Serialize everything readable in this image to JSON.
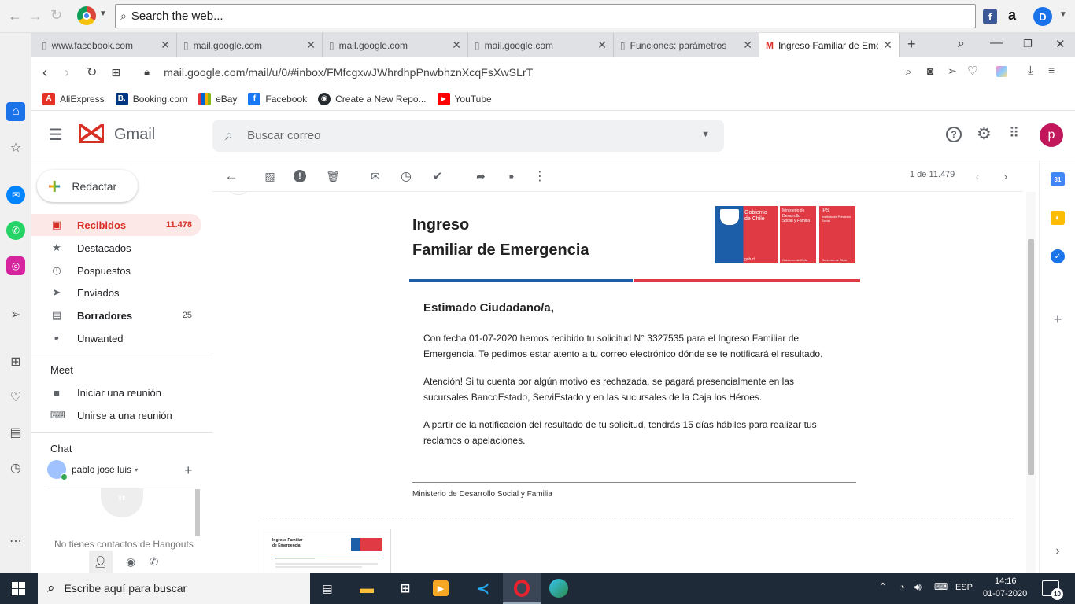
{
  "browser": {
    "search_placeholder": "Search the web...",
    "url": "mail.google.com/mail/u/0/#inbox/FMfcgxwJWhrdhpPnwbhznXcqFsXwSLrT",
    "tabs": [
      {
        "title": "www.facebook.com"
      },
      {
        "title": "mail.google.com"
      },
      {
        "title": "mail.google.com"
      },
      {
        "title": "mail.google.com"
      },
      {
        "title": "Funciones: parámetros"
      },
      {
        "title": "Ingreso Familiar de Emer"
      }
    ],
    "bookmarks": [
      {
        "label": "AliExpress",
        "color": "#e43225",
        "glyph": "A"
      },
      {
        "label": "Booking.com",
        "color": "#003580",
        "glyph": "B."
      },
      {
        "label": "eBay",
        "color": "#86b817",
        "glyph": "e"
      },
      {
        "label": "Facebook",
        "color": "#1877f2",
        "glyph": "f"
      },
      {
        "label": "Create a New Repo...",
        "color": "#24292e",
        "glyph": "◉"
      },
      {
        "label": "YouTube",
        "color": "#ff0000",
        "glyph": "▶"
      }
    ]
  },
  "gmail": {
    "logo_text": "Gmail",
    "search_placeholder": "Buscar correo",
    "avatar_letter": "p",
    "compose_label": "Redactar",
    "nav": [
      {
        "label": "Recibidos",
        "count": "11.478",
        "icon": "inbox-icon",
        "glyph": "▣",
        "active": true
      },
      {
        "label": "Destacados",
        "count": "",
        "icon": "star-icon",
        "glyph": "★"
      },
      {
        "label": "Pospuestos",
        "count": "",
        "icon": "clock-icon",
        "glyph": "◷"
      },
      {
        "label": "Enviados",
        "count": "",
        "icon": "send-icon",
        "glyph": "➤"
      },
      {
        "label": "Borradores",
        "count": "25",
        "icon": "draft-icon",
        "glyph": "▤",
        "bold": true
      },
      {
        "label": "Unwanted",
        "count": "",
        "icon": "label-icon",
        "glyph": "➧"
      }
    ],
    "meet": {
      "heading": "Meet",
      "start_label": "Iniciar una reunión",
      "join_label": "Unirse a una reunión"
    },
    "chat": {
      "heading": "Chat",
      "user": "pablo jose luis",
      "empty_text": "No tienes contactos de Hangouts"
    },
    "pager": "1 de 11.479"
  },
  "email": {
    "heading_line1": "Ingreso",
    "heading_line2": "Familiar de Emergencia",
    "logos": [
      {
        "line1": "Gobierno",
        "line2": "de Chile",
        "footer": "gob.cl"
      },
      {
        "line1": "Ministerio de",
        "line2": "Desarrollo Social y Familia",
        "footer": "Gobierno de Chile"
      },
      {
        "line1": "IPS",
        "line2": "Instituto de Previsión Social",
        "footer": "Gobierno de Chile"
      }
    ],
    "greeting": "Estimado Ciudadano/a,",
    "p1": "Con fecha 01-07-2020 hemos recibido tu solicitud N° 3327535 para el Ingreso Familiar de Emergencia. Te pedimos estar atento a tu correo electrónico dónde se te notificará el resultado.",
    "p2": "Atención! Si tu cuenta por algún motivo es rechazada, se pagará presencialmente en las sucursales BancoEstado, ServiEstado y en las sucursales de la Caja los Héroes.",
    "p3": "A partir de la notificación del resultado de tu solicitud, tendrás 15 días hábiles para realizar tus reclamos o apelaciones.",
    "footer": "Ministerio de Desarrollo Social y Familia",
    "thumb_title": "Ingreso Familiar de Emergencia"
  },
  "taskbar": {
    "search_placeholder": "Escribe aquí para buscar",
    "lang": "ESP",
    "time": "14:16",
    "date": "01-07-2020",
    "notif_count": "10"
  },
  "colors": {
    "gmail_red": "#d93025",
    "chile_blue": "#1c5ea8",
    "chile_red": "#e03a45",
    "taskbar": "#1f2a38"
  }
}
